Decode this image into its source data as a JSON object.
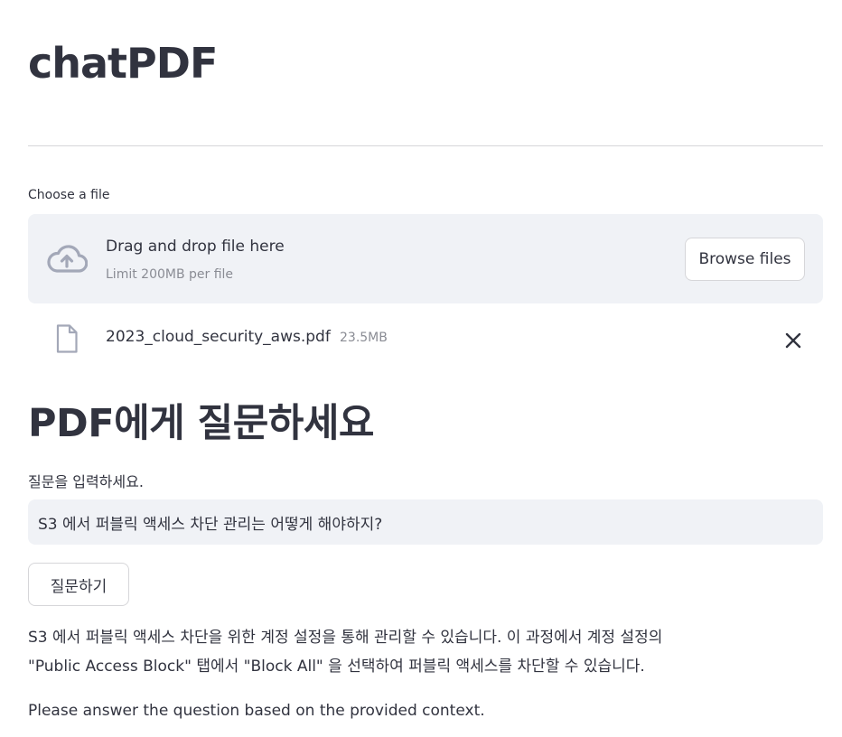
{
  "app": {
    "title": "chatPDF"
  },
  "uploader": {
    "label": "Choose a file",
    "drop_title": "Drag and drop file here",
    "drop_limit": "Limit 200MB per file",
    "browse_label": "Browse files",
    "icon": "cloud-upload-icon"
  },
  "file": {
    "name": "2023_cloud_security_aws.pdf",
    "size": "23.5MB",
    "icon": "file-icon",
    "remove_icon": "close-icon"
  },
  "qa": {
    "section_title": "PDF에게 질문하세요",
    "input_label": "질문을 입력하세요.",
    "input_value": "S3 에서 퍼블릭 액세스 차단 관리는 어떻게 해야하지?",
    "ask_label": "질문하기",
    "answer_line1": "S3 에서 퍼블릭 액세스 차단을 위한 계정 설정을 통해 관리할 수 있습니다. 이 과정에서 계정 설정의",
    "answer_line2": "\"Public Access Block\" 탭에서 \"Block All\" 을 선택하여 퍼블릭 액세스를 차단할 수 있습니다.",
    "note": "Please answer the question based on the provided context."
  },
  "colors": {
    "text": "#31333f",
    "muted": "#8a8c94",
    "panel": "#f0f2f6",
    "border": "#d6d6d9"
  }
}
